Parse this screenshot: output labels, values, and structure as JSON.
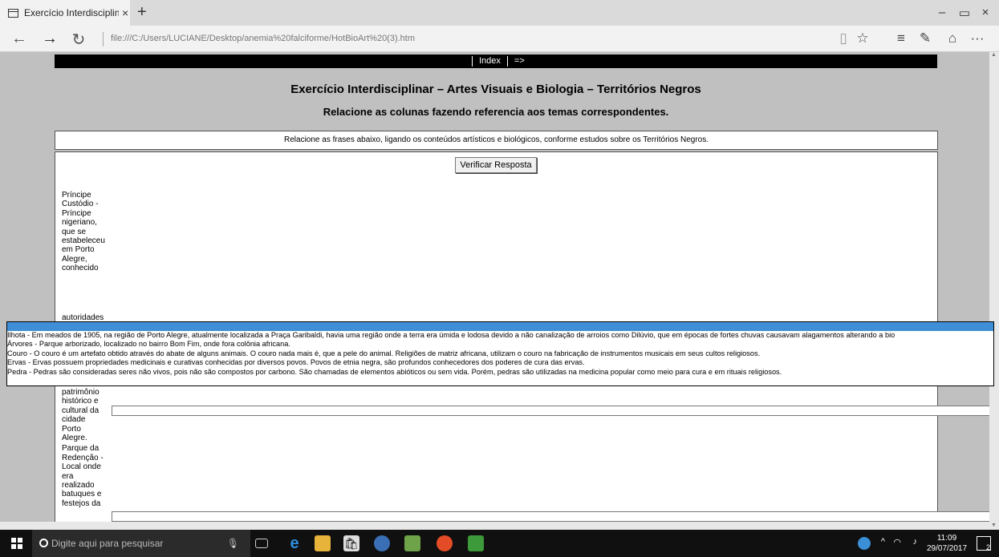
{
  "browser": {
    "tab_title": "Exercício Interdisciplinar",
    "tab_close": "×",
    "new_tab": "+",
    "address": "file:///C:/Users/LUCIANE/Desktop/anemia%20falciforme/HotBioArt%20(3).htm",
    "window_controls": {
      "minimize": "–",
      "maximize": "▭",
      "close": "×"
    },
    "nav": {
      "back": "←",
      "forward": "→",
      "refresh": "↻"
    },
    "tools": {
      "reading_view": "▯",
      "favorite": "☆",
      "hub": "≡",
      "notes": "✎",
      "share": "⌂",
      "more": "···"
    }
  },
  "page": {
    "top_links": [
      "Index",
      "=>"
    ],
    "title": "Exercício Interdisciplinar – Artes Visuais e Biologia – Territórios Negros",
    "subtitle": "Relacione as colunas fazendo referencia aos temas correspondentes.",
    "instruction": "Relacione as frases abaixo, ligando os conteúdos artísticos e biológicos, conforme estudos sobre os Territórios Negros.",
    "verify_button": "Verificar Resposta",
    "left_items": [
      "Príncipe Custódio - Príncipe nigeriano, que se estabeleceu em Porto Alegre, conhecido",
      "autoridades políticas da época.",
      "Mercado - Construção em estilo neoclássico, considerado patrimônio histórico e cultural da cidade Porto Alegre.",
      "Parque da Redenção - Local onde era realizado batuques e festejos da"
    ],
    "dropdown_options": [
      "Ilhota - Em meados de 1905, na região de Porto Alegre, atualmente localizada a Praça Garibaldi, havia uma região onde a terra era úmida e lodosa devido a não canalização de arroios como Dilúvio, que em épocas de fortes chuvas causavam alagamentos alterando a bio",
      "Árvores - Parque arborizado, localizado no bairro Bom Fim, onde fora colônia africana.",
      "Couro - O couro é um artefato obtido através do abate de alguns animais. O couro nada mais é, que a pele do animal. Religiões de matriz africana, utilizam o couro na fabricação de instrumentos musicais em seus cultos religiosos.",
      "Ervas - Ervas possuem propriedades medicinais e curativas conhecidas por diversos povos. Povos de etnia negra, são profundos conhecedores dos poderes de cura das ervas.",
      "Pedra - Pedras são consideradas seres não vivos, pois não são compostos por carbono. São chamadas de elementos abióticos ou sem vida. Porém, pedras são utilizadas na medicina popular como meio para cura e em rituais religiosos."
    ]
  },
  "taskbar": {
    "search_placeholder": "Digite aqui para pesquisar",
    "time": "11:09",
    "date": "29/07/2017",
    "notifications": "2"
  },
  "colors": {
    "page_bg": "#c0c0c0",
    "selected_option": "#3f8fd6",
    "taskbar": "#101010"
  }
}
